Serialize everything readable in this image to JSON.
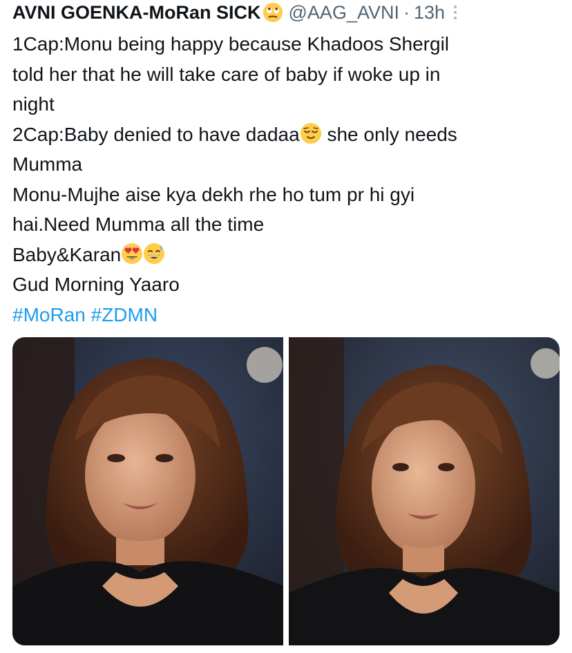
{
  "tweet": {
    "author_name": "AVNI GOENKA-MoRan SICK",
    "author_emoji": "face-with-rolling-eyes-emoji",
    "handle": "@AAG_AVNI",
    "separator": "·",
    "time": "13h",
    "lines": [
      "1Cap:Monu being happy because Khadoos Shergil",
      "told her that he will take care of baby if woke up in",
      "night"
    ],
    "line_2cap_before": "2Cap:Baby denied to have dadaa",
    "line_2cap_after": " she only needs",
    "line_mumma": "Mumma",
    "line_monu_1": "Monu-Mujhe aise kya dekh rhe ho tum pr hi gyi",
    "line_monu_2": "hai.Need Mumma all the time",
    "line_baby": "Baby&Karan",
    "line_gud": "Gud Morning Yaaro",
    "hashtags": [
      "#MoRan",
      "#ZDMN"
    ]
  },
  "emojis": {
    "dadaa": "relieved-face-emoji",
    "baby_1": "heart-eyes-emoji",
    "baby_2": "grinning-sweat-emoji"
  },
  "media": {
    "photos": [
      {
        "name": "photo-left"
      },
      {
        "name": "photo-right"
      }
    ]
  },
  "colors": {
    "text": "#0f1419",
    "secondary": "#536471",
    "link": "#1d9bf0"
  }
}
